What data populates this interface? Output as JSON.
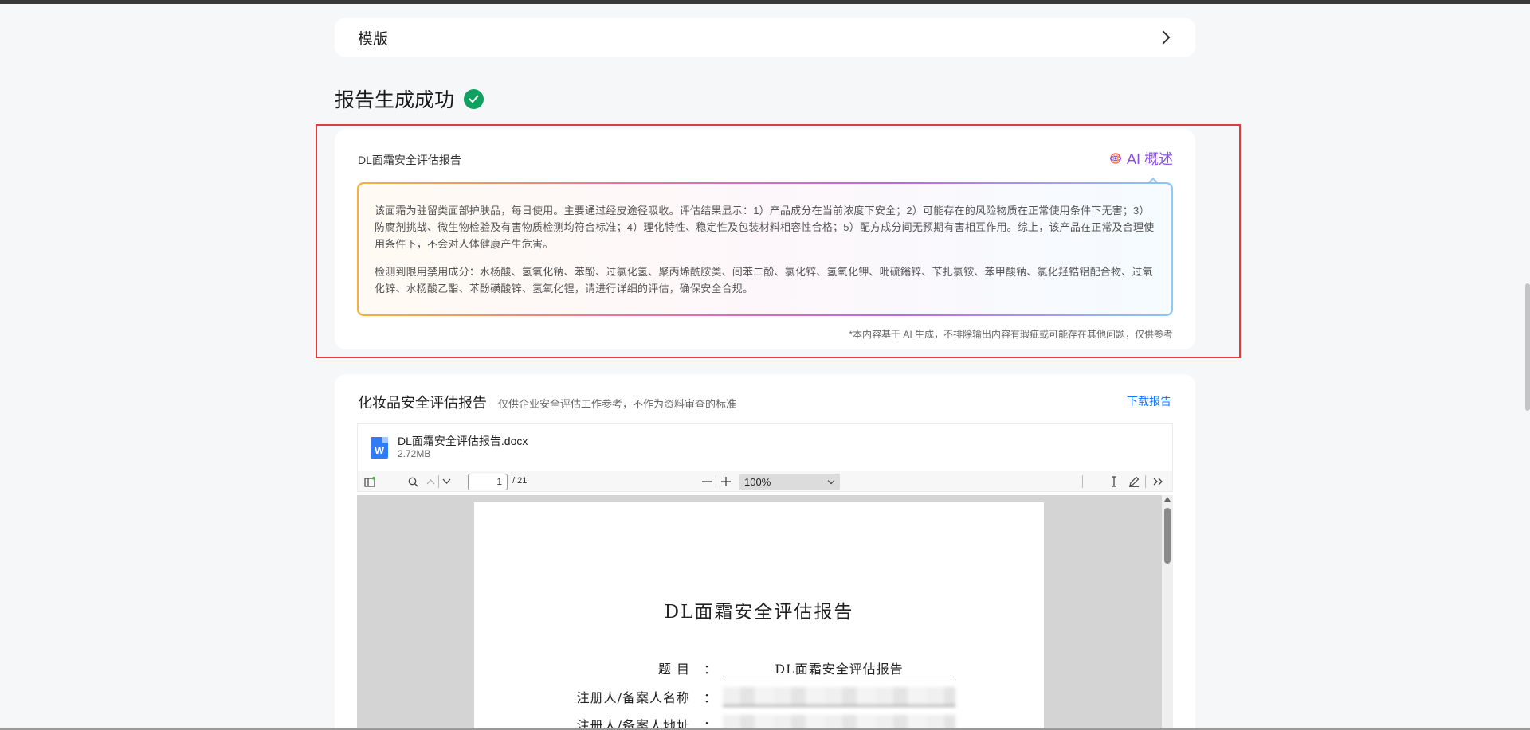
{
  "template_section": {
    "label": "模版"
  },
  "success": {
    "title": "报告生成成功"
  },
  "summary": {
    "doc_title": "DL面霜安全评估报告",
    "ai_tab_label": "AI 概述",
    "paragraph_1": "该面霜为驻留类面部护肤品，每日使用。主要通过经皮途径吸收。评估结果显示：1）产品成分在当前浓度下安全；2）可能存在的风险物质在正常使用条件下无害；3）防腐剂挑战、微生物检验及有害物质检测均符合标准；4）理化特性、稳定性及包装材料相容性合格；5）配方成分间无预期有害相互作用。综上，该产品在正常及合理使用条件下，不会对人体健康产生危害。",
    "paragraph_2": "检测到限用禁用成分：水杨酸、氢氧化钠、苯酚、过氯化氢、聚丙烯酰胺类、间苯二酚、氯化锌、氢氧化钾、吡硫鎓锌、苄扎氯铵、苯甲酸钠、氯化羟锆铝配合物、过氧化锌、水杨酸乙酯、苯酚磺酸锌、氢氧化锂，请进行详细的评估，确保安全合规。",
    "disclaimer": "*本内容基于 AI 生成，不排除输出内容有瑕疵或可能存在其他问题，仅供参考"
  },
  "report": {
    "title": "化妆品安全评估报告",
    "subtitle": "仅供企业安全评估工作参考，不作为资料审查的标准",
    "download_label": "下载报告",
    "file": {
      "name": "DL面霜安全评估报告.docx",
      "size": "2.72MB",
      "icon_letter": "W"
    },
    "viewer": {
      "current_page": "1",
      "total_pages": "/ 21",
      "zoom": "100%"
    },
    "page": {
      "heading": "DL面霜安全评估报告",
      "rows": [
        {
          "label": "题 目",
          "value": "DL面霜安全评估报告"
        },
        {
          "label": "注册人/备案人名称",
          "value": ""
        },
        {
          "label": "注册人/备案人地址",
          "value": ""
        }
      ]
    }
  },
  "icons": {
    "chevron": "chevron-right-icon",
    "check": "check-circle-icon",
    "ai": "ai-sparkle-icon",
    "word": "word-file-icon"
  }
}
